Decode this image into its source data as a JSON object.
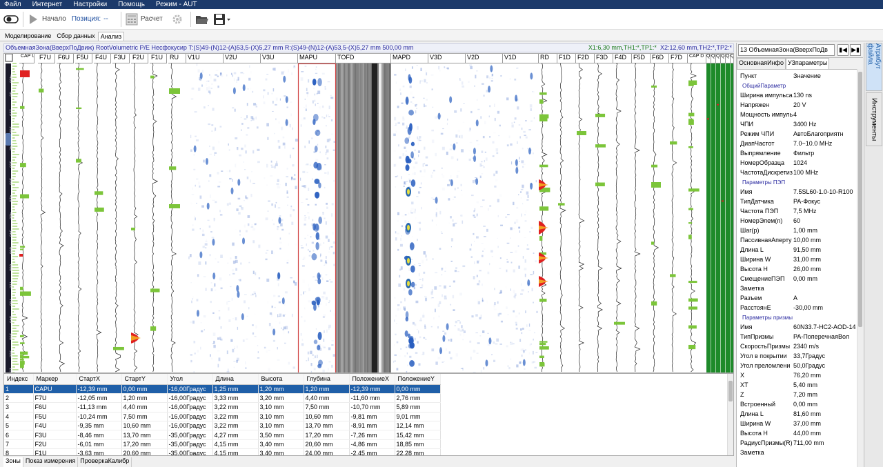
{
  "menu": [
    "Файл",
    "Интернет",
    "Настройки",
    "Помощь",
    "Режим - AUT"
  ],
  "toolbar": {
    "start": "Начало",
    "position_label": "Позиция:",
    "position_value": "--",
    "calc": "Расчет"
  },
  "tabs": [
    "Моделирование",
    "Сбор данных",
    "Анализ"
  ],
  "info_left": "ОбъемнаяЗона(ВверхПоДвиж)  RootVolumetric  P/E  Несфокусир  T:(S)49-(N)12-(A)53,5-(X)5,27  mm  R:(S)49-(N)12-(A)53,5-(X)5,27  mm  500,00  mm",
  "info_right_x1": "X1:6,30 mm,TH1:*,TP1:*",
  "info_right_x2": "X2:12,60 mm,TH2:*,TP2:*",
  "channels": [
    "CAP U",
    "F7U",
    "F6U",
    "F5U",
    "F4U",
    "F3U",
    "F2U",
    "F1U",
    "RU",
    "V1U",
    "V2U",
    "V3U",
    "MAPU",
    "TOFD",
    "MAPD",
    "V3D",
    "V2D",
    "V1D",
    "RD",
    "F1D",
    "F2D",
    "F3D",
    "F4D",
    "F5D",
    "F6D",
    "F7D",
    "CAP D",
    "Q1",
    "Q2",
    "Q3",
    "Q4",
    "Q5",
    "Q6"
  ],
  "ruler_labels": [
    "-460",
    "60",
    "120",
    "180",
    "240",
    "300",
    "360",
    "420",
    "480",
    "540",
    "600",
    "660",
    "720",
    "780",
    "840",
    "900",
    "960",
    "1020"
  ],
  "table": {
    "headers": [
      "Индекс",
      "Маркер",
      "СтартX",
      "СтартY",
      "Угол",
      "Длина",
      "Высота",
      "Глубина",
      "ПоложениеX",
      "ПоложениеY"
    ],
    "rows": [
      [
        "1",
        "CAPU",
        "-12,39 mm",
        "0,00 mm",
        "-16,00Градус",
        "1,25 mm",
        "1,20 mm",
        "1,20 mm",
        "-12,39 mm",
        "0,00 mm"
      ],
      [
        "2",
        "F7U",
        "-12,05 mm",
        "1,20 mm",
        "-16,00Градус",
        "3,33 mm",
        "3,20 mm",
        "4,40 mm",
        "-11,60 mm",
        "2,76 mm"
      ],
      [
        "3",
        "F6U",
        "-11,13 mm",
        "4,40 mm",
        "-16,00Градус",
        "3,22 mm",
        "3,10 mm",
        "7,50 mm",
        "-10,70 mm",
        "5,89 mm"
      ],
      [
        "4",
        "F5U",
        "-10,24 mm",
        "7,50 mm",
        "-16,00Градус",
        "3,22 mm",
        "3,10 mm",
        "10,60 mm",
        "-9,81 mm",
        "9,01 mm"
      ],
      [
        "5",
        "F4U",
        "-9,35 mm",
        "10,60 mm",
        "-16,00Градус",
        "3,22 mm",
        "3,10 mm",
        "13,70 mm",
        "-8,91 mm",
        "12,14 mm"
      ],
      [
        "6",
        "F3U",
        "-8,46 mm",
        "13,70 mm",
        "-35,00Градус",
        "4,27 mm",
        "3,50 mm",
        "17,20 mm",
        "-7,26 mm",
        "15,42 mm"
      ],
      [
        "7",
        "F2U",
        "-6,01 mm",
        "17,20 mm",
        "-35,00Градус",
        "4,15 mm",
        "3,40 mm",
        "20,60 mm",
        "-4,86 mm",
        "18,85 mm"
      ],
      [
        "8",
        "F1U",
        "-3,63 mm",
        "20,60 mm",
        "-35,00Градус",
        "4,15 mm",
        "3,40 mm",
        "24,00 mm",
        "-2,45 mm",
        "22,28 mm"
      ]
    ]
  },
  "bottom_tabs": [
    "Зоны",
    "Показ измерения",
    "ПроверкаКалибр"
  ],
  "right": {
    "zone_select": "13  ОбъемнаяЗона(ВверхПоДв",
    "tabs": [
      "ОсновнаяИнфо",
      "УЗпараметры"
    ],
    "props": [
      [
        "Пункт",
        "Значение"
      ],
      [
        "#ОбщийПараметр",
        ""
      ],
      [
        "Ширина импульса",
        "130 ns"
      ],
      [
        "Напряжен",
        "20 V"
      ],
      [
        "Мощность импуль",
        "4"
      ],
      [
        "ЧПИ",
        "3400 Hz"
      ],
      [
        "Режим ЧПИ",
        "АвтоБлагоприятн"
      ],
      [
        "ДиапЧастот",
        "7.0~10.0 MHz"
      ],
      [
        "Выпрямление",
        "Фильтр"
      ],
      [
        "НомерОбразца",
        "1024"
      ],
      [
        "ЧастотаДискретиз",
        "100 MHz"
      ],
      [
        "#Параметры ПЭП",
        ""
      ],
      [
        "Имя",
        "7.5SL60-1.0-10-R100"
      ],
      [
        "ТипДатчика",
        "PA-Фокус"
      ],
      [
        "Частота ПЭП",
        "7,5 MHz"
      ],
      [
        "НомерЭлем(n)",
        "60"
      ],
      [
        "Шаг(p)",
        "1,00 mm"
      ],
      [
        "ПассивнаяАперту",
        "10,00 mm"
      ],
      [
        "Длина L",
        "91,50 mm"
      ],
      [
        "Ширина W",
        "31,00 mm"
      ],
      [
        "Высота H",
        "26,00 mm"
      ],
      [
        "СмещениеПЭП",
        "0,00 mm"
      ],
      [
        "Заметка",
        ""
      ],
      [
        "Разъем",
        "A"
      ],
      [
        "РасстоянЕ",
        "-30,00 mm"
      ],
      [
        "#Параметры призмы",
        ""
      ],
      [
        "Имя",
        "60N33.7-HC2-AOD-14"
      ],
      [
        "ТипПризмы",
        "PA-ПоперечнаяВол"
      ],
      [
        "СкоростьПризмы",
        "2340 m/s"
      ],
      [
        "Угол в покрытии",
        "33,7Градус"
      ],
      [
        "Угол преломлени",
        "50,0Градус"
      ],
      [
        "X",
        "76,20 mm"
      ],
      [
        "XT",
        "5,40 mm"
      ],
      [
        "Z",
        "7,20 mm"
      ],
      [
        "Встроенный",
        "0,00 mm"
      ],
      [
        "Длина L",
        "81,60 mm"
      ],
      [
        "Ширина W",
        "37,00 mm"
      ],
      [
        "Высота H",
        "44,00 mm"
      ],
      [
        "РадиусПризмы(R)",
        "711,00 mm"
      ],
      [
        "Заметка",
        ""
      ]
    ]
  },
  "vtabs": [
    "Атрибут файла",
    "Инструменты"
  ]
}
